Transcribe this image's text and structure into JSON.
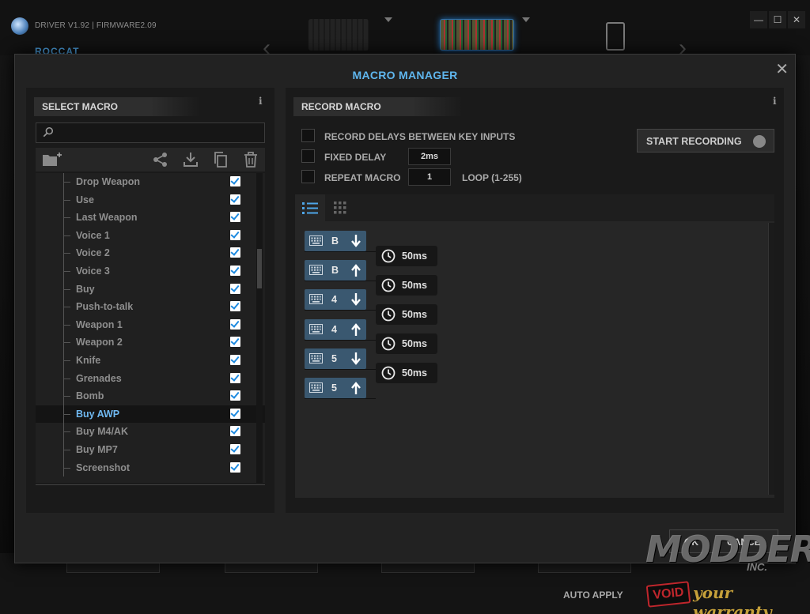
{
  "app": {
    "driver_version": "DRIVER V1.92 | FIRMWARE2.09",
    "brand": "ROCCAT",
    "auto_apply": "AUTO APPLY"
  },
  "modal": {
    "title": "MACRO MANAGER",
    "close_label": "✕"
  },
  "select_macro": {
    "header": "SELECT MACRO",
    "info": "i",
    "search_placeholder": "",
    "items": [
      {
        "label": "Drop Weapon",
        "checked": true,
        "selected": false
      },
      {
        "label": "Use",
        "checked": true,
        "selected": false
      },
      {
        "label": "Last Weapon",
        "checked": true,
        "selected": false
      },
      {
        "label": "Voice 1",
        "checked": true,
        "selected": false
      },
      {
        "label": "Voice 2",
        "checked": true,
        "selected": false
      },
      {
        "label": "Voice 3",
        "checked": true,
        "selected": false
      },
      {
        "label": "Buy",
        "checked": true,
        "selected": false
      },
      {
        "label": "Push-to-talk",
        "checked": true,
        "selected": false
      },
      {
        "label": "Weapon 1",
        "checked": true,
        "selected": false
      },
      {
        "label": "Weapon 2",
        "checked": true,
        "selected": false
      },
      {
        "label": "Knife",
        "checked": true,
        "selected": false
      },
      {
        "label": "Grenades",
        "checked": true,
        "selected": false
      },
      {
        "label": "Bomb",
        "checked": true,
        "selected": false
      },
      {
        "label": "Buy AWP",
        "checked": true,
        "selected": true
      },
      {
        "label": "Buy M4/AK",
        "checked": true,
        "selected": false
      },
      {
        "label": "Buy MP7",
        "checked": true,
        "selected": false
      },
      {
        "label": "Screenshot",
        "checked": true,
        "selected": false
      }
    ]
  },
  "record_macro": {
    "header": "RECORD MACRO",
    "info": "i",
    "record_delays_label": "RECORD DELAYS BETWEEN KEY INPUTS",
    "fixed_delay_label": "FIXED DELAY",
    "fixed_delay_value": "2ms",
    "repeat_label": "REPEAT MACRO",
    "repeat_value": "1",
    "loop_label": "LOOP (1-255)",
    "start_recording": "START RECORDING"
  },
  "sequence": [
    {
      "key": "B",
      "dir": "down",
      "delay": "50ms"
    },
    {
      "key": "B",
      "dir": "up",
      "delay": "50ms"
    },
    {
      "key": "4",
      "dir": "down",
      "delay": "50ms"
    },
    {
      "key": "4",
      "dir": "up",
      "delay": "50ms"
    },
    {
      "key": "5",
      "dir": "down",
      "delay": "50ms"
    },
    {
      "key": "5",
      "dir": "up",
      "delay": ""
    }
  ],
  "watermark": {
    "ok": "OK",
    "cancel": "CANCEL",
    "modders": "MODDERS",
    "inc": "INC.",
    "void": "VOID",
    "warranty": "your warranty"
  },
  "colors": {
    "accent_blue": "#5fb6ee",
    "selected_text": "#6fb8f0",
    "key_step_bg": "#3a5870",
    "check_blue": "#1d8ae0"
  }
}
